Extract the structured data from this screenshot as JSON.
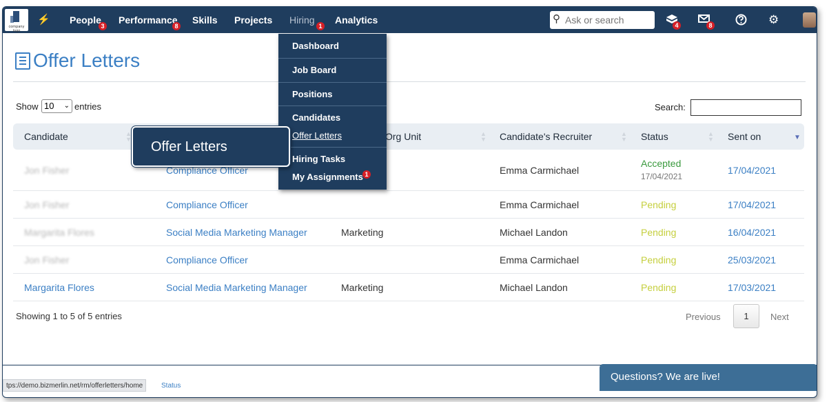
{
  "nav": {
    "logo_caption": "company logo",
    "items": [
      {
        "label": "People",
        "badge": "3"
      },
      {
        "label": "Performance",
        "badge": "8"
      },
      {
        "label": "Skills",
        "badge": ""
      },
      {
        "label": "Projects",
        "badge": ""
      },
      {
        "label": "Hiring",
        "badge": "1"
      },
      {
        "label": "Analytics",
        "badge": ""
      }
    ],
    "search_placeholder": "Ask or search",
    "cube_badge": "4",
    "mail_badge": "8",
    "icons": [
      "bolt-icon",
      "search-icon",
      "cube-icon",
      "mail-icon",
      "help-icon",
      "gear-icon",
      "avatar"
    ]
  },
  "page": {
    "title": "Offer Letters",
    "show_label": "Show",
    "entries_value": "10",
    "entries_label": "entries",
    "search_label": "Search:"
  },
  "dropdown": {
    "items": [
      {
        "label": "Dashboard"
      },
      {
        "label": "Job Board"
      },
      {
        "label": "Positions"
      },
      {
        "label": "Candidates"
      },
      {
        "label": "Offer Letters"
      },
      {
        "label": "Hiring Tasks"
      },
      {
        "label": "My Assignments",
        "badge": "1"
      }
    ]
  },
  "callout": "Offer Letters",
  "table": {
    "headers": {
      "candidate": "Candidate",
      "org_unit": "Org Unit",
      "recruiter": "Candidate's Recruiter",
      "status": "Status",
      "sent_on": "Sent on"
    },
    "rows": [
      {
        "candidate": "Jon Fisher",
        "position": "Compliance Officer",
        "org_unit": "",
        "recruiter": "Emma Carmichael",
        "status": "Accepted",
        "status_date": "17/04/2021",
        "sent_on": "17/04/2021"
      },
      {
        "candidate": "Jon Fisher",
        "position": "Compliance Officer",
        "org_unit": "",
        "recruiter": "Emma Carmichael",
        "status": "Pending",
        "status_date": "",
        "sent_on": "17/04/2021"
      },
      {
        "candidate": "Margarita Flores",
        "position": "Social Media Marketing Manager",
        "org_unit": "Marketing",
        "recruiter": "Michael Landon",
        "status": "Pending",
        "status_date": "",
        "sent_on": "16/04/2021"
      },
      {
        "candidate": "Jon Fisher",
        "position": "Compliance Officer",
        "org_unit": "",
        "recruiter": "Emma Carmichael",
        "status": "Pending",
        "status_date": "",
        "sent_on": "25/03/2021"
      },
      {
        "candidate": "Margarita Flores",
        "position": "Social Media Marketing Manager",
        "org_unit": "Marketing",
        "recruiter": "Michael Landon",
        "status": "Pending",
        "status_date": "",
        "sent_on": "17/03/2021"
      }
    ]
  },
  "footer": {
    "info": "Showing 1 to 5 of 5 entries",
    "previous": "Previous",
    "page": "1",
    "next": "Next"
  },
  "statusbar": {
    "url": "tps://demo.bizmerlin.net/rm/offerletters/home",
    "status": "Status"
  },
  "chat": "Questions? We are live!"
}
